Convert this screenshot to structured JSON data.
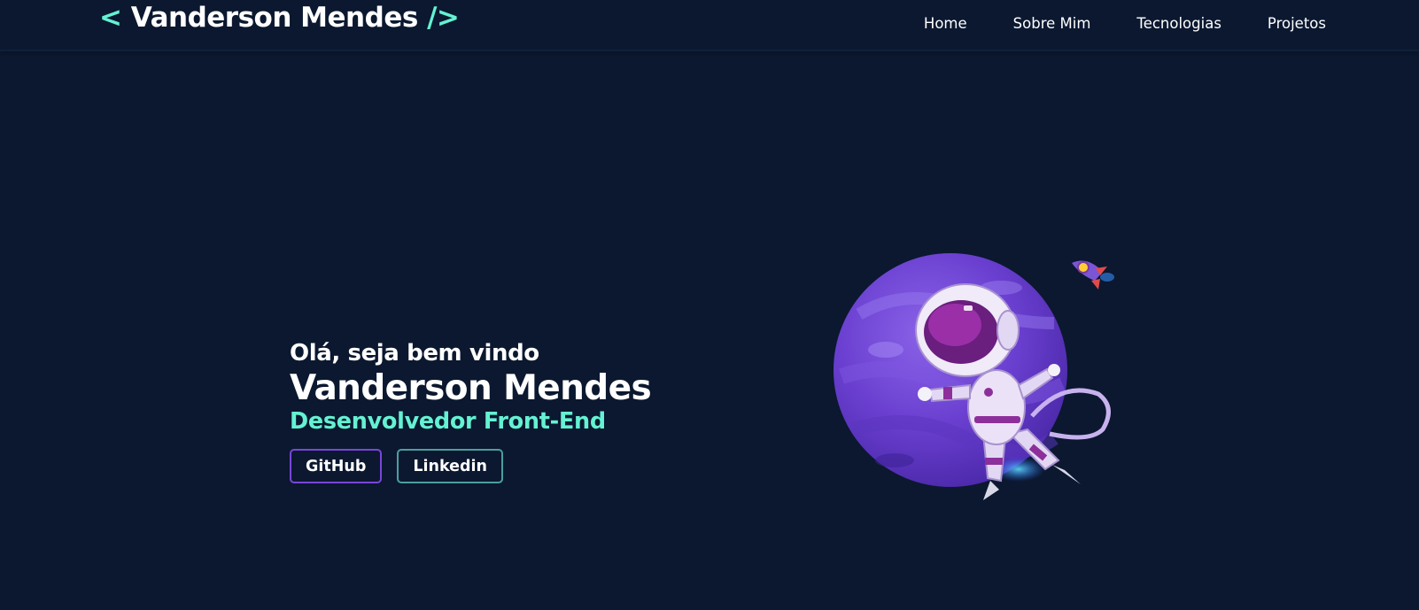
{
  "header": {
    "logo_open": "<",
    "logo_name": "Vanderson Mendes",
    "logo_close": "/>",
    "nav": [
      {
        "label": "Home"
      },
      {
        "label": "Sobre Mim"
      },
      {
        "label": "Tecnologias"
      },
      {
        "label": "Projetos"
      }
    ]
  },
  "hero": {
    "greeting": "Olá, seja bem vindo",
    "name": "Vanderson Mendes",
    "role": "Desenvolvedor Front-End",
    "buttons": {
      "github": "GitHub",
      "linkedin": "Linkedin"
    },
    "illustration": "astronaut-planet-rocket"
  },
  "colors": {
    "background": "#0b1830",
    "accent": "#64f2d2",
    "github_border": "#7a45d8",
    "linkedin_border": "#4c9ea0"
  }
}
